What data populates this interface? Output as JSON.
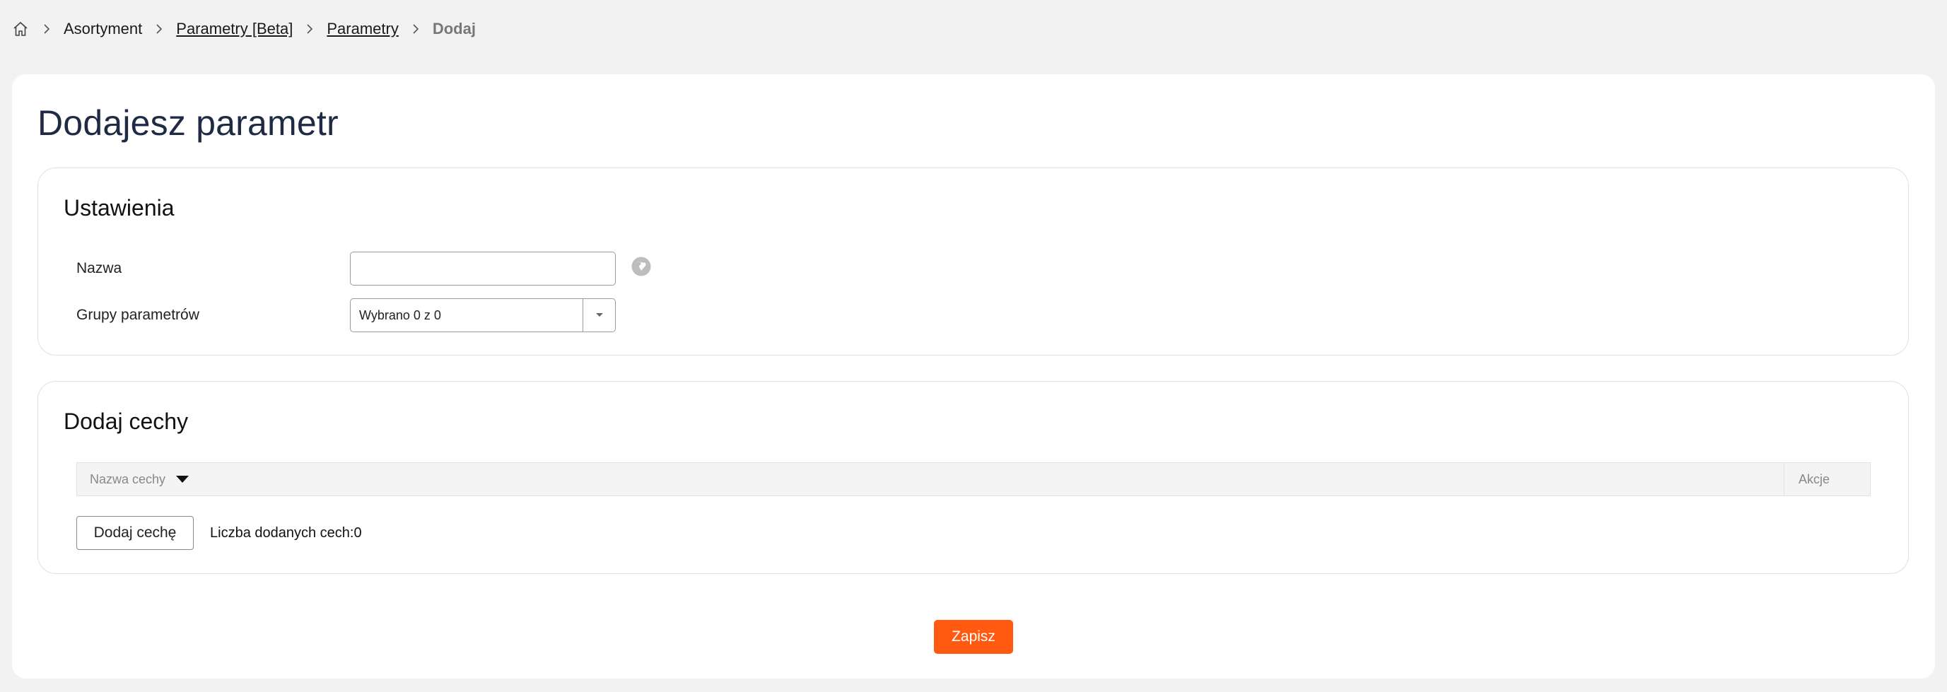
{
  "breadcrumb": {
    "home_icon": "home-icon",
    "items": [
      {
        "label": "Asortyment",
        "link": false
      },
      {
        "label": "Parametry [Beta]",
        "link": true
      },
      {
        "label": "Parametry",
        "link": true
      },
      {
        "label": "Dodaj",
        "current": true
      }
    ]
  },
  "page": {
    "title": "Dodajesz parametr"
  },
  "settings": {
    "title": "Ustawienia",
    "name_label": "Nazwa",
    "name_value": "",
    "name_placeholder": "",
    "groups_label": "Grupy parametrów",
    "groups_value": "Wybrano 0 z 0"
  },
  "features": {
    "title": "Dodaj cechy",
    "columns": [
      "Nazwa cechy",
      "Akcje"
    ],
    "add_button": "Dodaj cechę",
    "count_text": "Liczba dodanych cech:0"
  },
  "footer": {
    "save_label": "Zapisz"
  },
  "colors": {
    "accent": "#ff5a0f",
    "title": "#1f2a44",
    "background": "#f2f2f2"
  }
}
